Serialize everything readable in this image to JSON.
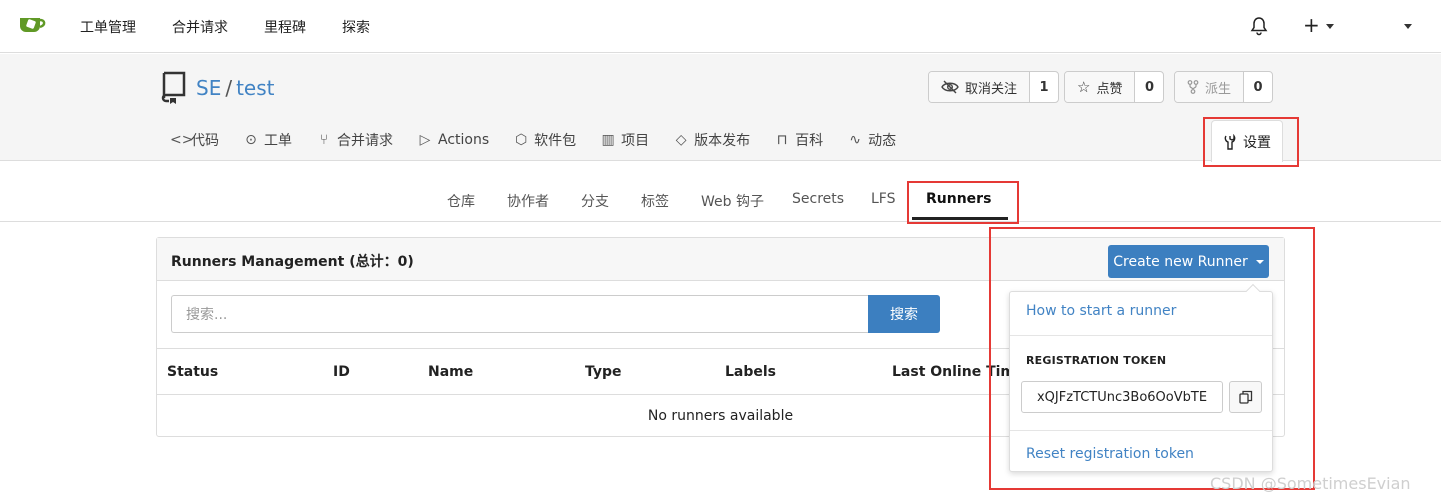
{
  "topnav": {
    "items": [
      "工单管理",
      "合并请求",
      "里程碑",
      "探索"
    ]
  },
  "repo": {
    "owner": "SE",
    "separator": "/",
    "name": "test",
    "unwatch_label": "取消关注",
    "unwatch_count": "1",
    "star_label": "点赞",
    "star_count": "0",
    "fork_label": "派生",
    "fork_count": "0",
    "tabs": [
      {
        "icon": "code-icon",
        "label": "代码"
      },
      {
        "icon": "issue-icon",
        "label": "工单"
      },
      {
        "icon": "pull-request-icon",
        "label": "合并请求"
      },
      {
        "icon": "actions-icon",
        "label": "Actions"
      },
      {
        "icon": "package-icon",
        "label": "软件包"
      },
      {
        "icon": "project-icon",
        "label": "项目"
      },
      {
        "icon": "tag-icon",
        "label": "版本发布"
      },
      {
        "icon": "book-icon",
        "label": "百科"
      },
      {
        "icon": "pulse-icon",
        "label": "动态"
      }
    ],
    "settings_label": "设置"
  },
  "subtabs": [
    "仓库",
    "协作者",
    "分支",
    "标签",
    "Web 钩子",
    "Secrets",
    "LFS",
    "Runners"
  ],
  "panel": {
    "title": "Runners Management (总计：0)",
    "create_button": "Create new Runner",
    "search_placeholder": "搜索...",
    "search_button": "搜索",
    "columns": [
      "Status",
      "ID",
      "Name",
      "Type",
      "Labels",
      "Last Online Time"
    ],
    "empty_text": "No runners available"
  },
  "dropdown": {
    "how_to": "How to start a runner",
    "token_header": "REGISTRATION TOKEN",
    "token_value": "xQJFzTCTUnc3Bo6OoVbTE",
    "reset": "Reset registration token"
  },
  "watermark": "CSDN @SometimesEvian",
  "colors": {
    "primary": "#3c7fc0",
    "link": "#4183c4",
    "highlight": "#e53935"
  }
}
